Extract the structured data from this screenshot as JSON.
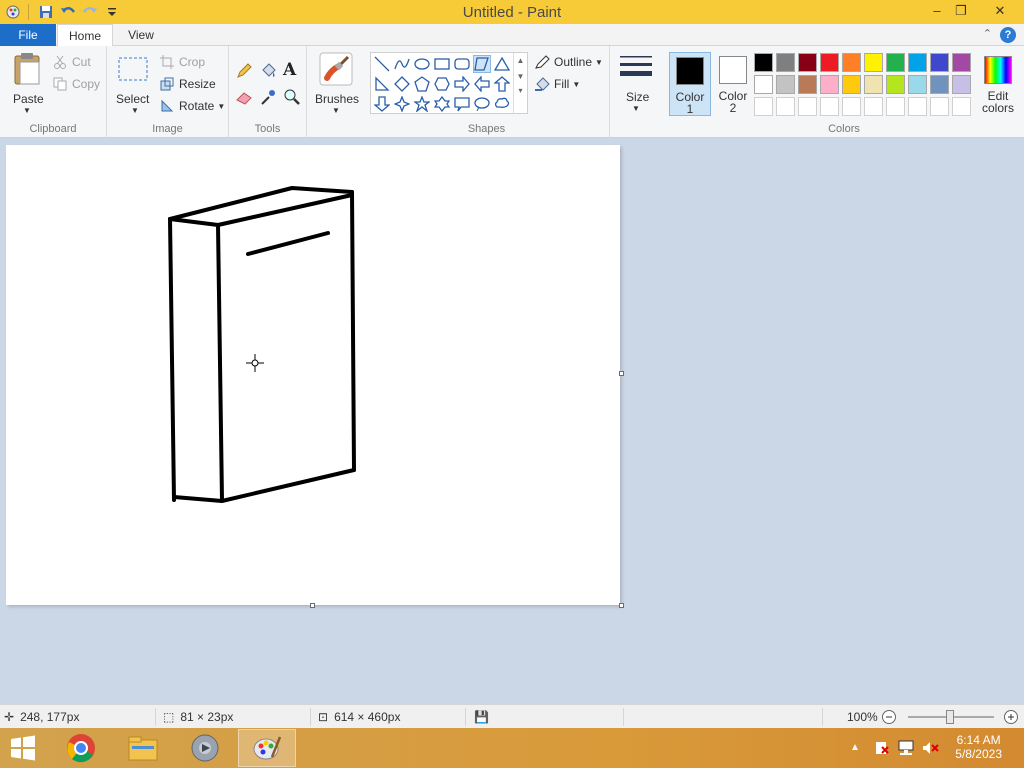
{
  "window": {
    "title": "Untitled - Paint",
    "minimize": "–",
    "restore": "❐",
    "close": "✕"
  },
  "tabs": {
    "file": "File",
    "home": "Home",
    "view": "View"
  },
  "help": "?",
  "ribbon": {
    "clipboard": {
      "label": "Clipboard",
      "paste": "Paste",
      "cut": "Cut",
      "copy": "Copy"
    },
    "image": {
      "label": "Image",
      "select": "Select",
      "crop": "Crop",
      "resize": "Resize",
      "rotate": "Rotate"
    },
    "tools": {
      "label": "Tools"
    },
    "brushes": {
      "label": "Brushes"
    },
    "shapes": {
      "label": "Shapes",
      "outline": "Outline",
      "fill": "Fill"
    },
    "size": {
      "label": "Size"
    },
    "colors": {
      "label": "Colors",
      "color1_label": "Color",
      "color1_num": "1",
      "color2_label": "Color",
      "color2_num": "2",
      "edit_label": "Edit",
      "edit_label2": "colors",
      "color1": "#000000",
      "color2": "#ffffff",
      "palette_row1": [
        "#000000",
        "#7f7f7f",
        "#880015",
        "#ed1c24",
        "#ff7f27",
        "#fff200",
        "#22b14c",
        "#00a2e8",
        "#3f48cc",
        "#a349a4"
      ],
      "palette_row2": [
        "#ffffff",
        "#c3c3c3",
        "#b97a57",
        "#ffaec9",
        "#ffc90e",
        "#efe4b0",
        "#b5e61d",
        "#99d9ea",
        "#7092be",
        "#c8bfe7"
      ],
      "palette_row3": [
        "#ffffff",
        "#ffffff",
        "#ffffff",
        "#ffffff",
        "#ffffff",
        "#ffffff",
        "#ffffff",
        "#ffffff",
        "#ffffff",
        "#ffffff"
      ]
    }
  },
  "status": {
    "cursor_pos": "248, 177px",
    "selection_size": "81 × 23px",
    "canvas_size": "614 × 460px",
    "zoom": "100%"
  },
  "taskbar": {
    "time": "6:14 AM",
    "date": "5/8/2023",
    "apps": [
      "start-icon",
      "chrome-icon",
      "file-explorer-icon",
      "media-player-icon",
      "paint-icon"
    ]
  }
}
